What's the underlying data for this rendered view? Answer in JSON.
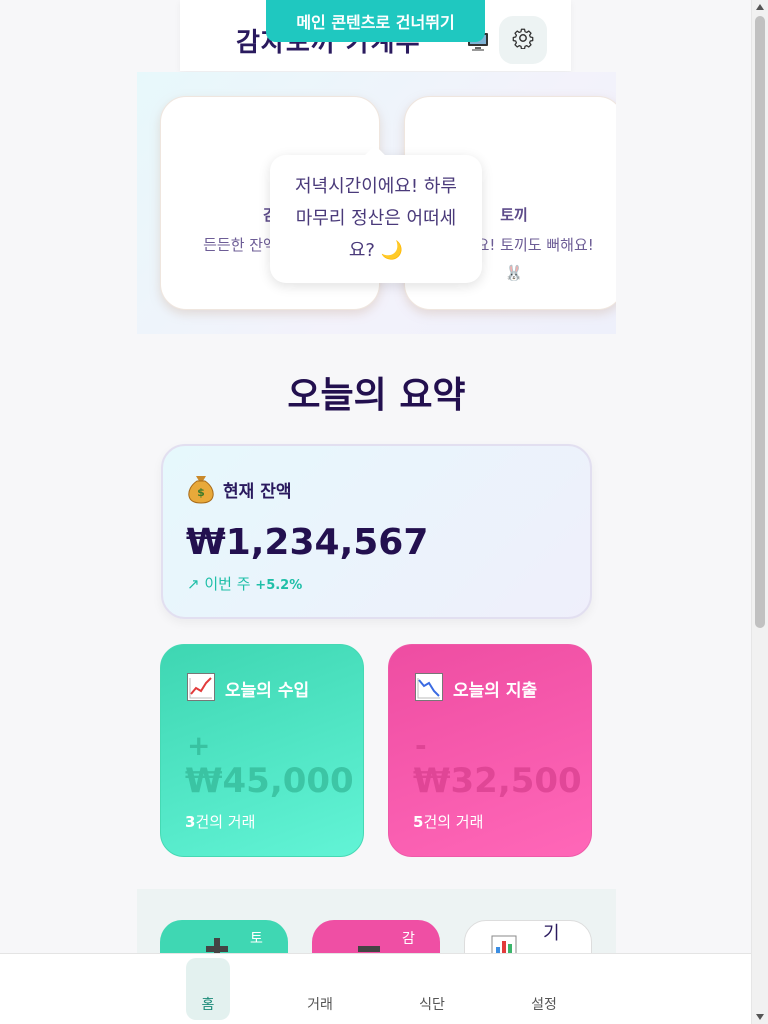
{
  "skip_link": "메인 콘텐츠로 건너뛰기",
  "header": {
    "app_title": "감자토끼 가계부",
    "device_icon": "monitor-icon",
    "settings_icon": "gear-icon"
  },
  "characters": [
    {
      "name": "감",
      "message": "든든한 잔액 유지해보"
    },
    {
      "name": "토끼",
      "message": "관리네요! 토끼도 뻐해요! 🐰"
    }
  ],
  "speech_bubble": "저녁시간이에요! 하루 마무리 정산은 어떠세요? 🌙",
  "summary": {
    "title": "오늘의 요약",
    "balance": {
      "icon": "money-bag-icon",
      "label": "현재 잔액",
      "amount": "₩1,234,567",
      "change_prefix": "↗ 이번 주",
      "change_value": "+5.2%"
    },
    "income": {
      "icon": "chart-up-icon",
      "label": "오늘의 수입",
      "sign": "+",
      "amount": "₩45,000",
      "count_num": "3",
      "count_text": "건의 거래"
    },
    "expense": {
      "icon": "chart-down-icon",
      "label": "오늘의 지출",
      "sign": "-",
      "amount": "₩32,500",
      "count_num": "5",
      "count_text": "건의 거래"
    }
  },
  "quick_actions": [
    {
      "icon": "plus-icon",
      "label": "토"
    },
    {
      "icon": "minus-icon",
      "label": "감"
    },
    {
      "icon": "bar-chart-icon",
      "label": "기"
    }
  ],
  "bottom_nav": [
    {
      "label": "홈",
      "active": true
    },
    {
      "label": "거래",
      "active": false
    },
    {
      "label": "식단",
      "active": false
    },
    {
      "label": "설정",
      "active": false
    }
  ],
  "colors": {
    "accent_teal": "#1fc8c0",
    "income_green": "#3ed6b2",
    "expense_pink": "#ee4da2",
    "title_navy": "#23104f"
  }
}
